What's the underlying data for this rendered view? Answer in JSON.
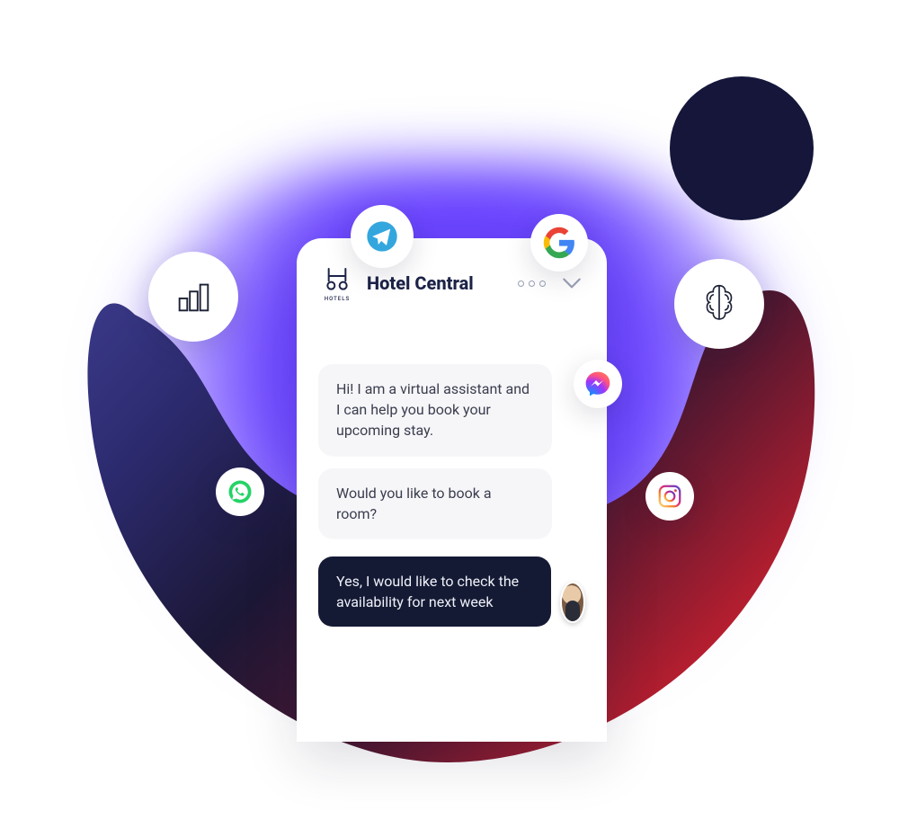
{
  "chat": {
    "brand_sub": "HOTELS",
    "title": "Hotel Central",
    "messages": {
      "bot1": "Hi! I am a virtual assistant and I can help you book your upcoming stay.",
      "bot2": "Would you like to book a room?",
      "user1": "Yes, I would like to check the availability for next week"
    }
  },
  "icons": {
    "bar": "bar-chart-icon",
    "telegram": "telegram-icon",
    "google": "google-icon",
    "brain": "brain-icon",
    "whatsapp": "whatsapp-icon",
    "fbmessenger": "messenger-icon",
    "instagram": "instagram-icon"
  },
  "colors": {
    "accent_purple": "#6a44ff",
    "dark_navy": "#151a34",
    "bowl_left": "#2c2a6e",
    "bowl_right": "#b81e2f"
  }
}
